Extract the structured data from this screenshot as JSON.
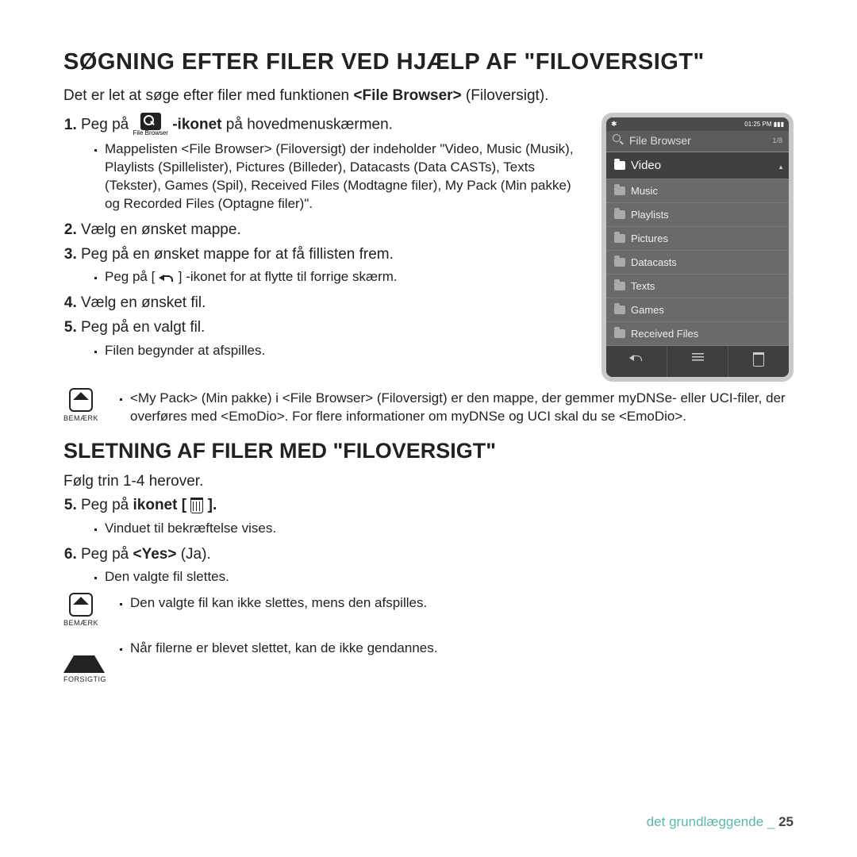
{
  "heading1": "SØGNING EFTER FILER VED HJÆLP AF \"FILOVERSIGT\"",
  "intro_a": "Det er let at søge efter filer med funktionen ",
  "intro_b": "<File Browser>",
  "intro_c": " (Filoversigt).",
  "step1_a": "Peg på ",
  "step1_iconcaption": "File Browser",
  "step1_b": "-ikonet",
  "step1_c": " på hovedmenuskærmen.",
  "step1_sub": "Mappelisten <File Browser> (Filoversigt) der indeholder \"Video, Music (Musik), Playlists (Spillelister), Pictures (Billeder), Datacasts (Data CASTs), Texts (Tekster), Games (Spil), Received Files (Modtagne filer), My Pack (Min pakke) og Recorded Files (Optagne filer)\".",
  "step2": "Vælg en ønsket mappe.",
  "step3": "Peg på en ønsket mappe for at få fillisten frem.",
  "step3_sub_a": "Peg på [ ",
  "step3_sub_b": " ] -ikonet for at flytte til forrige skærm.",
  "step4": "Vælg en ønsket fil.",
  "step5": "Peg på en valgt fil.",
  "step5_sub": "Filen begynder at afspilles.",
  "note1_label": "BEMÆRK",
  "note1_text": "<My Pack> (Min pakke) i <File Browser> (Filoversigt) er den mappe, der gemmer myDNSe- eller UCI-filer, der overføres med <EmoDio>. For flere informationer om myDNSe og UCI skal du se <EmoDio>.",
  "heading2": "SLETNING AF FILER MED \"FILOVERSIGT\"",
  "follow": "Følg trin 1-4 herover.",
  "del5_a": "Peg på ",
  "del5_b": "ikonet [ ",
  "del5_c": " ].",
  "del5_sub": "Vinduet til bekræftelse vises.",
  "del6_a": "Peg på ",
  "del6_b": "<Yes>",
  "del6_c": " (Ja).",
  "del6_sub": "Den valgte fil slettes.",
  "note2_label": "BEMÆRK",
  "note2_text": "Den valgte fil kan ikke slettes, mens den afspilles.",
  "caution_label": "FORSIGTIG",
  "caution_text": "Når filerne er blevet slettet, kan de ikke gendannes.",
  "footer_section": "det grundlæggende _ ",
  "footer_page": "25",
  "device": {
    "time": "01:25 PM",
    "title": "File Browser",
    "count": "1/8",
    "items": [
      "Video",
      "Music",
      "Playlists",
      "Pictures",
      "Datacasts",
      "Texts",
      "Games",
      "Received Files"
    ],
    "active_index": 0
  }
}
